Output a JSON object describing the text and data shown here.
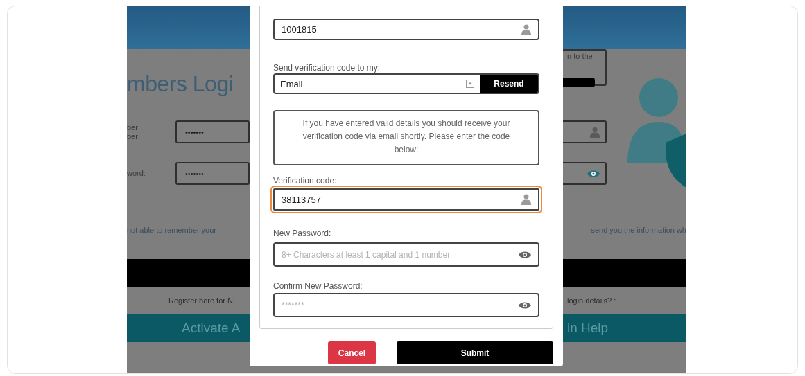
{
  "background": {
    "heading": "mbers Logi",
    "fields": [
      {
        "kind": "text",
        "label_lines": [
          "ber",
          "ber:"
        ],
        "placeholder": "•••••••"
      },
      {
        "kind": "password",
        "label_lines": [
          "word:"
        ],
        "placeholder": "•••••••"
      }
    ],
    "callout_text": "n to the",
    "notice_left": "not able to remember your",
    "notice_right": "send you the information wh",
    "register_left": "Register here for N",
    "register_right": "login details? :",
    "activate_left": "Activate A",
    "activate_right": "in Help"
  },
  "modal": {
    "fields": [
      {
        "kind": "text",
        "value": "1001815",
        "focused": false
      },
      {
        "kind": "select",
        "label": "Send verification code to my:",
        "value": "Email",
        "button": "Resend"
      },
      {
        "kind": "info",
        "text": "If you have entered valid details you should receive your verification code via email shortly. Please enter the code below:"
      },
      {
        "kind": "text",
        "label": "Verification code:",
        "value": "38113757",
        "focused": true
      },
      {
        "kind": "password",
        "label": "New Password:",
        "placeholder": "8+ Characters at least 1 capital and 1 number",
        "focused": false
      },
      {
        "kind": "password",
        "label": "Confirm New Password:",
        "placeholder": "*******",
        "focused": false
      }
    ],
    "buttons": [
      {
        "label": "Cancel",
        "kind": "danger"
      },
      {
        "label": "Submit",
        "kind": "primary"
      }
    ]
  }
}
